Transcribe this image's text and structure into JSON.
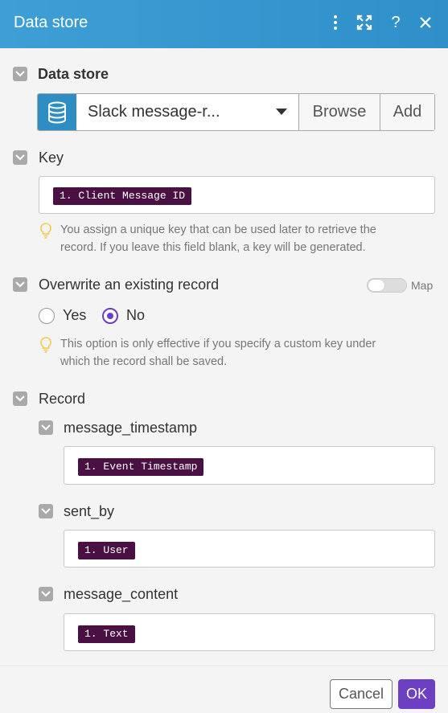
{
  "header": {
    "title": "Data store",
    "icons": [
      "more-vertical-icon",
      "expand-icon",
      "help-icon",
      "close-icon"
    ]
  },
  "data_store": {
    "label": "Data store",
    "selected": "Slack message-r...",
    "browse_label": "Browse",
    "add_label": "Add"
  },
  "key": {
    "label": "Key",
    "pill": "1. Client Message ID",
    "hint_line1": "You assign a unique key that can be used later to retrieve the",
    "hint_line2": "record. If you leave this field blank, a key will be generated."
  },
  "overwrite": {
    "label": "Overwrite an existing record",
    "map_label": "Map",
    "yes_label": "Yes",
    "no_label": "No",
    "selected": "No",
    "hint_line1": "This option is only effective if you specify a custom key under",
    "hint_line2": "which the record shall be saved."
  },
  "record": {
    "label": "Record",
    "fields": [
      {
        "label": "message_timestamp",
        "pill": "1. Event Timestamp"
      },
      {
        "label": "sent_by",
        "pill": "1. User"
      },
      {
        "label": "message_content",
        "pill": "1. Text"
      }
    ]
  },
  "footer": {
    "cancel_label": "Cancel",
    "ok_label": "OK"
  },
  "colors": {
    "header": "#3e9fd6",
    "pill": "#4b1043",
    "accent": "#6d3fc2"
  }
}
